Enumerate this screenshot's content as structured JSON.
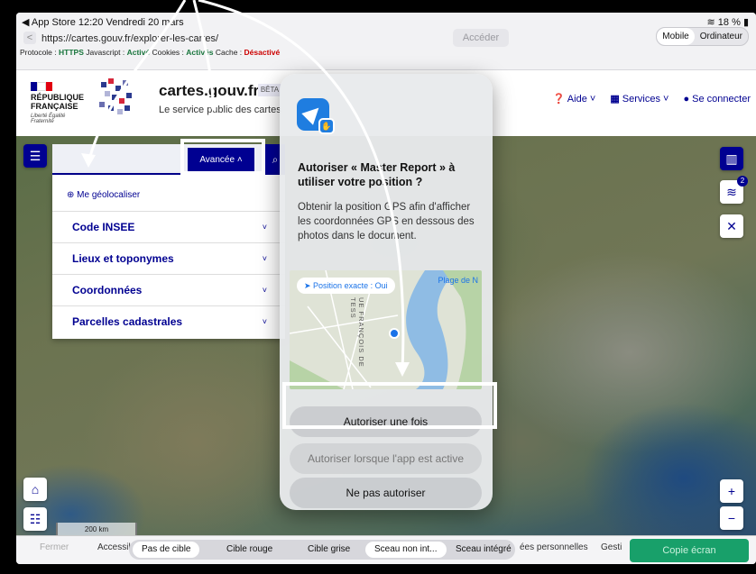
{
  "status": {
    "left": "◀ App Store  12:20  Vendredi 20 mars",
    "right": "18 %"
  },
  "browser": {
    "url": "https://cartes.gouv.fr/explorer-les-cartes/",
    "go_label": "Accéder",
    "mode_mobile": "Mobile",
    "mode_desktop": "Ordinateur",
    "back_glyph": "<"
  },
  "protocol_line": {
    "p1": "Protocole : ",
    "p2": "HTTPS",
    "p3": "  Javascript : ",
    "p4": "Activé",
    "p5": "  Cookies : ",
    "p6": "Activés",
    "p7": "  Cache : ",
    "p8": "Désactivé"
  },
  "header": {
    "rf_line1": "RÉPUBLIQUE",
    "rf_line2": "FRANÇAISE",
    "rf_motto": "Liberté Égalité Fraternité",
    "site_title": "cartes.gouv.fr",
    "beta_badge": "BÊTA",
    "site_subtitle": "Le service public des cartes",
    "nav": {
      "help": "Aide",
      "services": "Services",
      "login": "Se connecter"
    }
  },
  "search": {
    "advanced_label": "Avancée  ˄",
    "geoloc_label": "Me géolocaliser",
    "items": [
      {
        "label": "Code INSEE"
      },
      {
        "label": "Lieux et toponymes"
      },
      {
        "label": "Coordonnées"
      },
      {
        "label": "Parcelles cadastrales"
      }
    ]
  },
  "map": {
    "scale": "200 km",
    "layers_badge": "2"
  },
  "dialog": {
    "title": "Autoriser « Master Report » à utiliser votre position ?",
    "body": "Obtenir la position GPS afin d'afficher les coordonnées GPS en dessous des photos dans le document.",
    "precise_pill": "Position exacte : Oui",
    "poi": "Plage de N",
    "street": "UE FRANÇOIS DE TESS",
    "btn_once": "Autoriser une fois",
    "btn_while": "Autoriser lorsque l'app est active",
    "btn_deny": "Ne pas autoriser"
  },
  "bottom": {
    "close": "Fermer",
    "accessib": "Accessib",
    "chips": [
      "Pas de cible",
      "Cible rouge",
      "Cible grise",
      "Sceau non int...",
      "Sceau intégré"
    ],
    "personal": "ées personnelles",
    "gestion": "Gesti",
    "copy": "Copie écran"
  },
  "colors": {
    "brand_blue": "#000091",
    "ios_blue": "#1a73e8",
    "copy_green": "#18a06a"
  }
}
